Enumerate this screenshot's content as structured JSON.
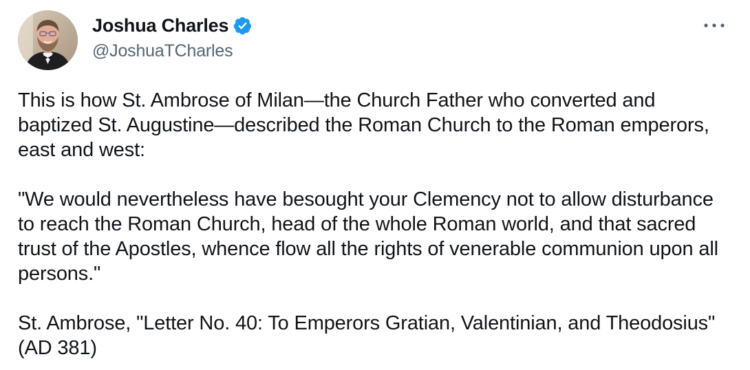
{
  "author": {
    "display_name": "Joshua Charles",
    "handle": "@JoshuaTCharles",
    "verified": true,
    "verified_color": "#1d9bf0",
    "avatar_icon": "profile-photo"
  },
  "menu": {
    "more_icon": "ellipsis-icon"
  },
  "tweet": {
    "paragraphs": [
      "This is how St. Ambrose of Milan—the Church Father who converted and baptized St. Augustine—described the Roman Church to the Roman emperors, east and west:",
      "\"We would nevertheless have besought your Clemency not to allow disturbance to reach the Roman Church, head of the whole Roman world, and that sacred trust of the Apostles, whence flow all the rights of venerable communion upon all persons.\"",
      "St. Ambrose, \"Letter No. 40: To Emperors Gratian, Valentinian, and Theodosius\" (AD 381)"
    ]
  },
  "colors": {
    "text_primary": "#0f1419",
    "text_secondary": "#536471",
    "background": "#ffffff"
  }
}
